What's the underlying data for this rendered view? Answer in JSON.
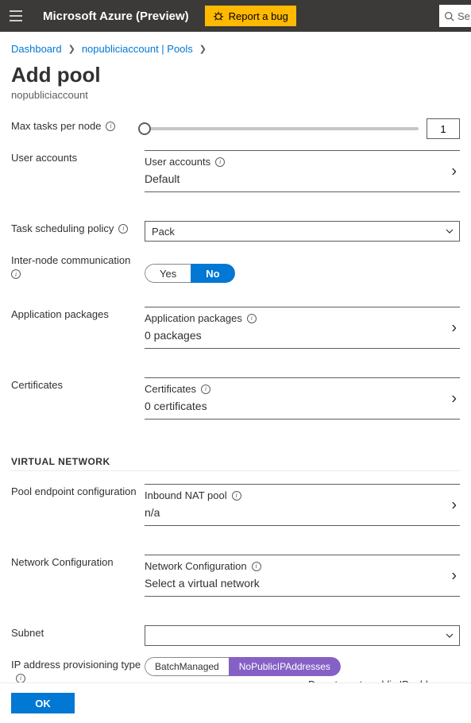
{
  "topbar": {
    "app_title": "Microsoft Azure (Preview)",
    "bug_label": "Report a bug",
    "search_placeholder": "Se"
  },
  "breadcrumb": {
    "items": [
      "Dashboard",
      "nopubliciaccount | Pools"
    ]
  },
  "page": {
    "title": "Add pool",
    "subtitle": "nopubliciaccount"
  },
  "form": {
    "max_tasks": {
      "label": "Max tasks per node",
      "value": "1"
    },
    "user_accounts": {
      "label": "User accounts",
      "heading": "User accounts",
      "value": "Default"
    },
    "task_sched": {
      "label": "Task scheduling policy",
      "selected": "Pack"
    },
    "internode": {
      "label": "Inter-node communication",
      "yes": "Yes",
      "no": "No"
    },
    "app_packages": {
      "label": "Application packages",
      "heading": "Application packages",
      "value": "0 packages"
    },
    "certs": {
      "label": "Certificates",
      "heading": "Certificates",
      "value": "0 certificates"
    },
    "vnet_section": "VIRTUAL NETWORK",
    "pool_endpoint": {
      "label": "Pool endpoint configuration",
      "heading": "Inbound NAT pool",
      "value": "n/a"
    },
    "net_config": {
      "label": "Network Configuration",
      "heading": "Network Configuration",
      "value": "Select a virtual network"
    },
    "subnet": {
      "label": "Subnet",
      "selected": ""
    },
    "ip_prov": {
      "label": "IP address provisioning type",
      "opt_batch": "BatchManaged",
      "opt_nopub": "NoPublicIPAddresses",
      "help": "Do not create public IP addresses."
    }
  },
  "footer": {
    "ok": "OK"
  }
}
